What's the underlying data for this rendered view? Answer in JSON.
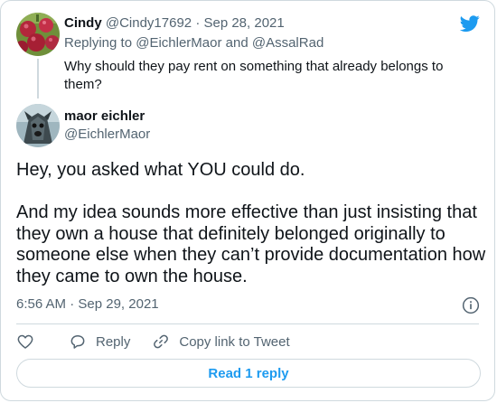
{
  "parent_tweet": {
    "name": "Cindy",
    "handle": "@Cindy17692",
    "separator": "·",
    "date": "Sep 28, 2021",
    "replying_prefix": "Replying to",
    "reply_user_1": "@EichlerMaor",
    "reply_and": "and",
    "reply_user_2": "@AssalRad",
    "text": "Why should they pay rent on something that already belongs to them?"
  },
  "main_tweet": {
    "name": "maor eichler",
    "handle": "@EichlerMaor",
    "paragraph_1": "Hey, you asked what YOU could do.",
    "paragraph_2": "And my idea sounds more effective than just insisting that they own a house that definitely belonged originally to someone else when they can’t provide documentation how they came to own the house.",
    "time": "6:56 AM",
    "separator": "·",
    "date": "Sep 29, 2021"
  },
  "actions": {
    "reply_label": "Reply",
    "copy_label": "Copy link to Tweet"
  },
  "read_replies_label": "Read 1 reply",
  "icons": {
    "brand": "twitter-bird-icon",
    "info": "info-icon",
    "like": "heart-icon",
    "reply": "speech-bubble-icon",
    "copy": "link-icon"
  },
  "colors": {
    "brand_blue": "#1d9bf0",
    "text": "#0f1419",
    "muted": "#536471",
    "border": "#cfd9de"
  }
}
